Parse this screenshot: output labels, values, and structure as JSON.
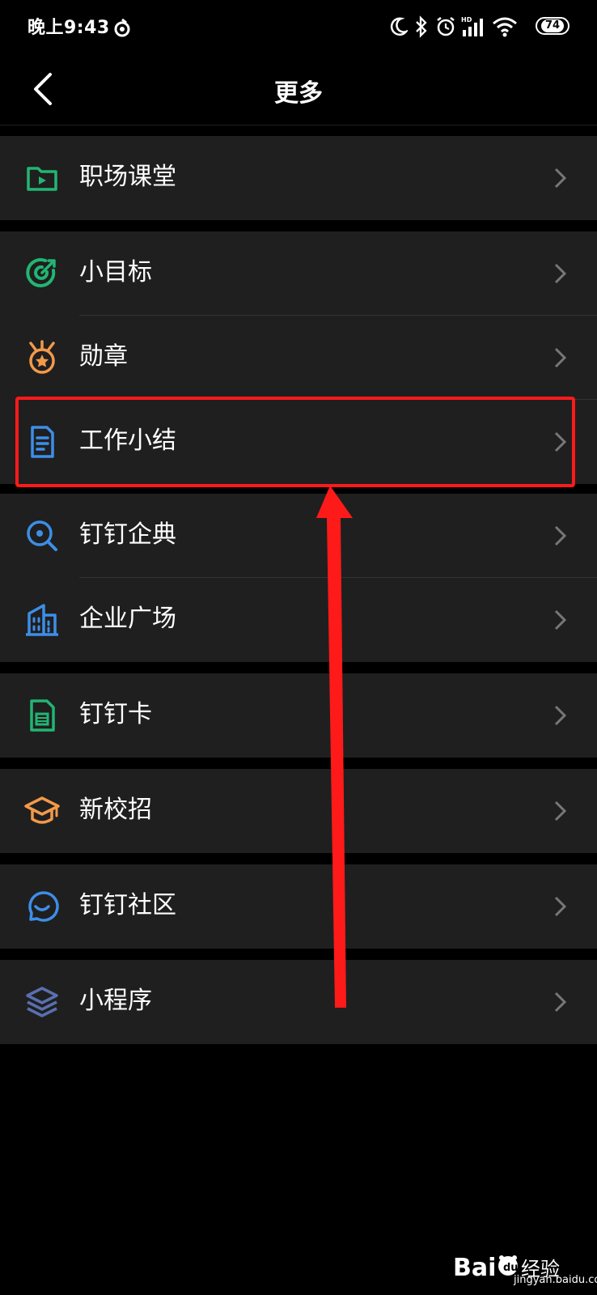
{
  "status": {
    "time": "晚上9:43",
    "battery": "74",
    "network": "HD"
  },
  "header": {
    "title": "更多"
  },
  "groups": [
    {
      "items": [
        {
          "label": "职场课堂",
          "icon": "video-folder-icon",
          "color": "#22b573"
        }
      ]
    },
    {
      "items": [
        {
          "label": "小目标",
          "icon": "target-icon",
          "color": "#22b573"
        },
        {
          "label": "勋章",
          "icon": "medal-icon",
          "color": "#f2994a"
        },
        {
          "label": "工作小结",
          "icon": "document-icon",
          "color": "#3d8ee8"
        }
      ]
    },
    {
      "items": [
        {
          "label": "钉钉企典",
          "icon": "search-magnifier-icon",
          "color": "#3d8ee8"
        },
        {
          "label": "企业广场",
          "icon": "building-icon",
          "color": "#3d8ee8"
        }
      ]
    },
    {
      "items": [
        {
          "label": "钉钉卡",
          "icon": "card-icon",
          "color": "#22b573"
        }
      ]
    },
    {
      "items": [
        {
          "label": "新校招",
          "icon": "graduation-cap-icon",
          "color": "#f2994a"
        }
      ]
    },
    {
      "items": [
        {
          "label": "钉钉社区",
          "icon": "chat-bubble-icon",
          "color": "#3d8ee8"
        }
      ]
    },
    {
      "items": [
        {
          "label": "小程序",
          "icon": "layers-icon",
          "color": "#5a6fb0"
        }
      ]
    }
  ],
  "annotation": {
    "color": "#ff1a1a",
    "target": "工作小结"
  },
  "watermark": {
    "text": "jingyan.baidu.com",
    "brand": "Bai du 经验"
  }
}
